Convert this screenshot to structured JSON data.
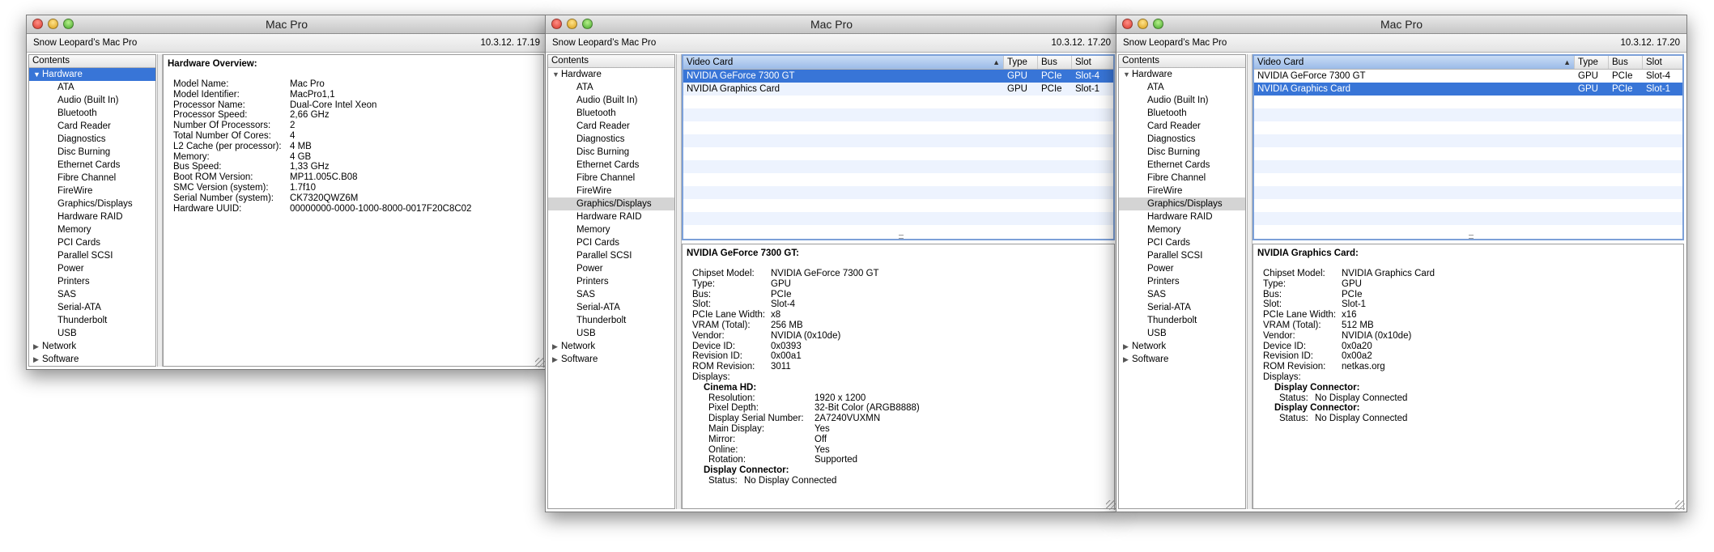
{
  "windows": [
    {
      "title": "Mac Pro",
      "machine": "Snow Leopard’s Mac Pro",
      "timestamp": "10.3.12. 17.19",
      "contents_header": "Contents",
      "tree": {
        "hardware": "Hardware",
        "items": [
          "ATA",
          "Audio (Built In)",
          "Bluetooth",
          "Card Reader",
          "Diagnostics",
          "Disc Burning",
          "Ethernet Cards",
          "Fibre Channel",
          "FireWire",
          "Graphics/Displays",
          "Hardware RAID",
          "Memory",
          "PCI Cards",
          "Parallel SCSI",
          "Power",
          "Printers",
          "SAS",
          "Serial-ATA",
          "Thunderbolt",
          "USB"
        ],
        "network": "Network",
        "software": "Software"
      },
      "overview": {
        "heading": "Hardware Overview:",
        "rows": [
          {
            "k": "Model Name:",
            "v": "Mac Pro"
          },
          {
            "k": "Model Identifier:",
            "v": "MacPro1,1"
          },
          {
            "k": "Processor Name:",
            "v": "Dual-Core Intel Xeon"
          },
          {
            "k": "Processor Speed:",
            "v": "2,66 GHz"
          },
          {
            "k": "Number Of Processors:",
            "v": "2"
          },
          {
            "k": "Total Number Of Cores:",
            "v": "4"
          },
          {
            "k": "L2 Cache (per processor):",
            "v": "4 MB"
          },
          {
            "k": "Memory:",
            "v": "4 GB"
          },
          {
            "k": "Bus Speed:",
            "v": "1,33 GHz"
          },
          {
            "k": "Boot ROM Version:",
            "v": "MP11.005C.B08"
          },
          {
            "k": "SMC Version (system):",
            "v": "1.7f10"
          },
          {
            "k": "Serial Number (system):",
            "v": "CK7320QWZ6M"
          },
          {
            "k": "Hardware UUID:",
            "v": "00000000-0000-1000-8000-0017F20C8C02"
          }
        ]
      }
    },
    {
      "title": "Mac Pro",
      "machine": "Snow Leopard’s Mac Pro",
      "timestamp": "10.3.12. 17.20",
      "contents_header": "Contents",
      "table": {
        "columns": [
          "Video Card",
          "Type",
          "Bus",
          "Slot"
        ],
        "rows": [
          {
            "name": "NVIDIA GeForce 7300 GT",
            "type": "GPU",
            "bus": "PCIe",
            "slot": "Slot-4"
          },
          {
            "name": "NVIDIA Graphics Card",
            "type": "GPU",
            "bus": "PCIe",
            "slot": "Slot-1"
          }
        ]
      },
      "detail": {
        "heading": "NVIDIA GeForce 7300 GT:",
        "rows": [
          {
            "k": "Chipset Model:",
            "v": "NVIDIA GeForce 7300 GT"
          },
          {
            "k": "Type:",
            "v": "GPU"
          },
          {
            "k": "Bus:",
            "v": "PCIe"
          },
          {
            "k": "Slot:",
            "v": "Slot-4"
          },
          {
            "k": "PCIe Lane Width:",
            "v": "x8"
          },
          {
            "k": "VRAM (Total):",
            "v": "256 MB"
          },
          {
            "k": "Vendor:",
            "v": "NVIDIA (0x10de)"
          },
          {
            "k": "Device ID:",
            "v": "0x0393"
          },
          {
            "k": "Revision ID:",
            "v": "0x00a1"
          },
          {
            "k": "ROM Revision:",
            "v": "3011"
          }
        ],
        "displays_label": "Displays:",
        "cinema_label": "Cinema HD:",
        "cinema_rows": [
          {
            "k": "Resolution:",
            "v": "1920 x 1200"
          },
          {
            "k": "Pixel Depth:",
            "v": "32-Bit Color (ARGB8888)"
          },
          {
            "k": "Display Serial Number:",
            "v": "2A7240VUXMN"
          },
          {
            "k": "Main Display:",
            "v": "Yes"
          },
          {
            "k": "Mirror:",
            "v": "Off"
          },
          {
            "k": "Online:",
            "v": "Yes"
          },
          {
            "k": "Rotation:",
            "v": "Supported"
          }
        ],
        "connector_label": "Display Connector:",
        "status_k": "Status:",
        "status_v": "No Display Connected"
      }
    },
    {
      "title": "Mac Pro",
      "machine": "Snow Leopard’s Mac Pro",
      "timestamp": "10.3.12. 17.20",
      "contents_header": "Contents",
      "detail": {
        "heading": "NVIDIA Graphics Card:",
        "rows": [
          {
            "k": "Chipset Model:",
            "v": "NVIDIA Graphics Card"
          },
          {
            "k": "Type:",
            "v": "GPU"
          },
          {
            "k": "Bus:",
            "v": "PCIe"
          },
          {
            "k": "Slot:",
            "v": "Slot-1"
          },
          {
            "k": "PCIe Lane Width:",
            "v": "x16"
          },
          {
            "k": "VRAM (Total):",
            "v": "512 MB"
          },
          {
            "k": "Vendor:",
            "v": "NVIDIA (0x10de)"
          },
          {
            "k": "Device ID:",
            "v": "0x0a20"
          },
          {
            "k": "Revision ID:",
            "v": "0x00a2"
          },
          {
            "k": "ROM Revision:",
            "v": "netkas.org"
          }
        ],
        "displays_label": "Displays:",
        "connector_label": "Display Connector:",
        "status_k": "Status:",
        "status_v": "No Display Connected"
      }
    }
  ]
}
